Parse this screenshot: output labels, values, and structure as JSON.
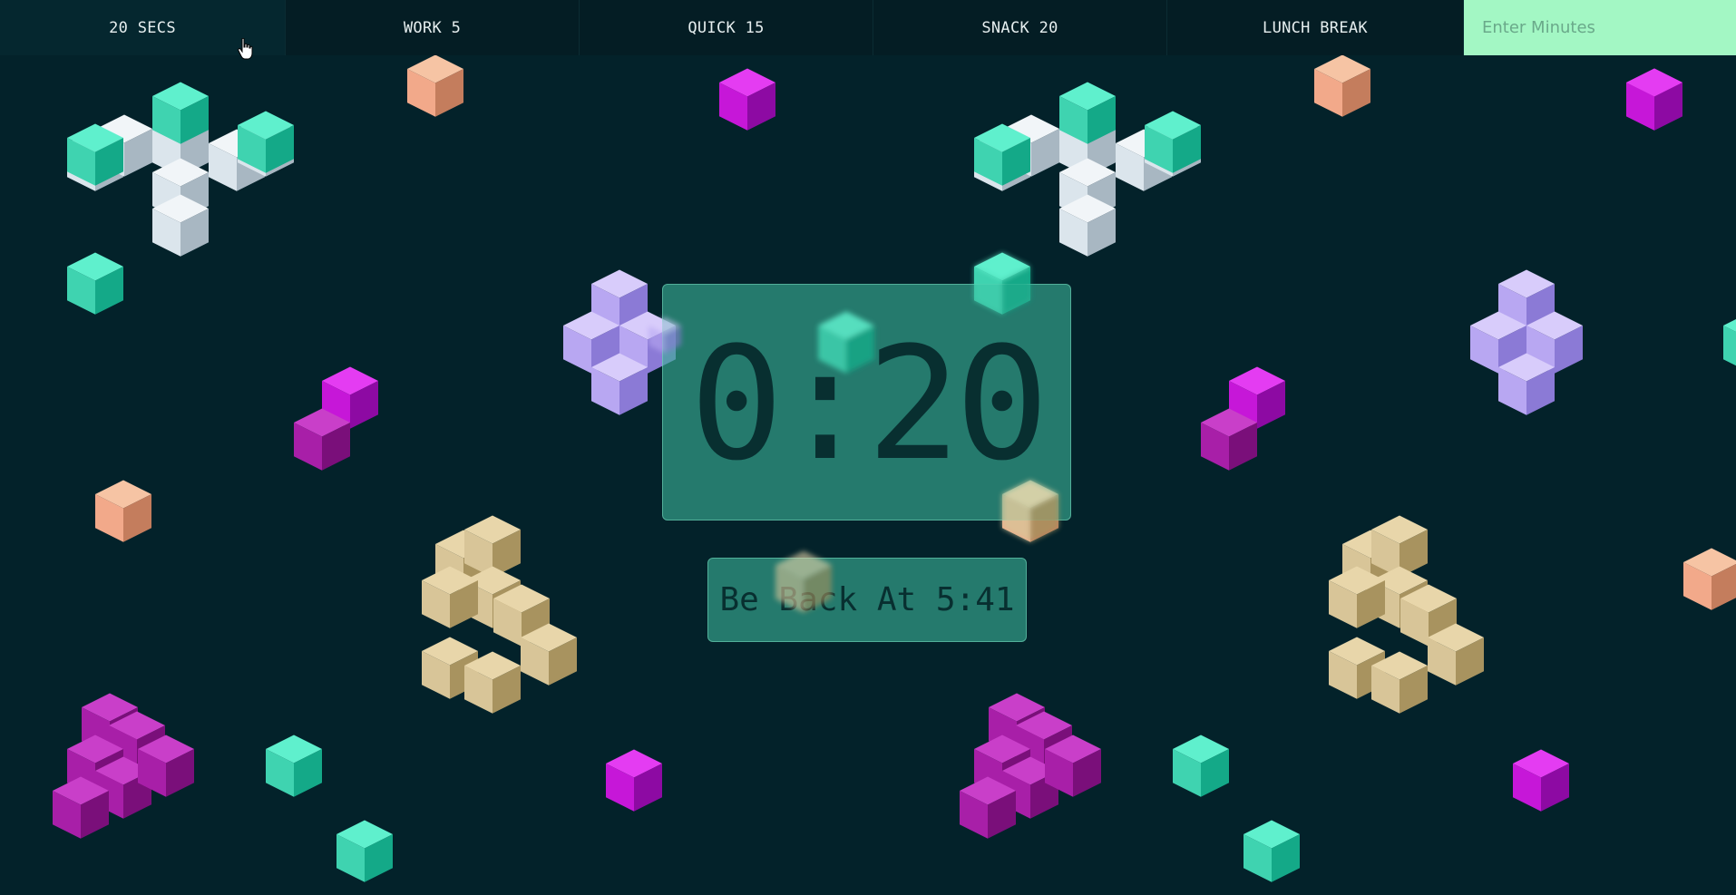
{
  "nav": {
    "buttons": [
      {
        "label": "20 SECS"
      },
      {
        "label": "WORK 5"
      },
      {
        "label": "QUICK 15"
      },
      {
        "label": "SNACK 20"
      },
      {
        "label": "LUNCH BREAK"
      }
    ],
    "minutes_input": {
      "placeholder": "Enter Minutes",
      "value": ""
    }
  },
  "timer": {
    "display": "0:20",
    "back_at": "Be Back At 5:41"
  },
  "colors": {
    "background": "#03222a",
    "panel": "#3ab096",
    "input_bg": "#a3f7c4",
    "teal": "#3fd3b0",
    "magenta": "#c617d8",
    "lavender": "#c5b8f5",
    "peach": "#f2b08a",
    "tan": "#d8c598",
    "white": "#e6eef2"
  },
  "icons": [
    "cube-icon",
    "hand-pointer-icon"
  ]
}
